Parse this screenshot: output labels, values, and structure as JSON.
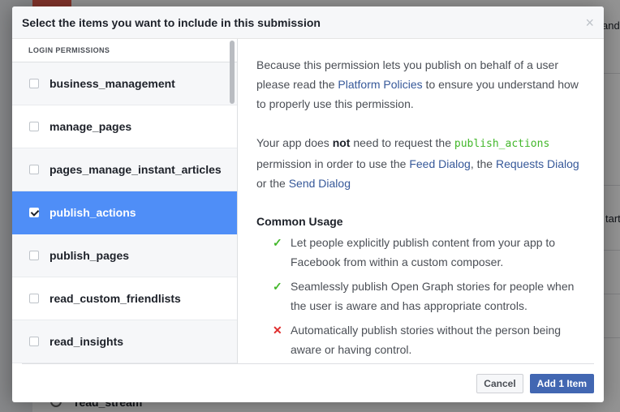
{
  "dialog": {
    "title": "Select the items you want to include in this submission",
    "close_icon": "×",
    "cancel_label": "Cancel",
    "add_label": "Add 1 Item"
  },
  "sidebar": {
    "section_header": "LOGIN PERMISSIONS",
    "items": [
      {
        "label": "business_management",
        "checked": false
      },
      {
        "label": "manage_pages",
        "checked": false
      },
      {
        "label": "pages_manage_instant_articles",
        "checked": false
      },
      {
        "label": "publish_actions",
        "checked": true
      },
      {
        "label": "publish_pages",
        "checked": false
      },
      {
        "label": "read_custom_friendlists",
        "checked": false
      },
      {
        "label": "read_insights",
        "checked": false
      }
    ]
  },
  "detail": {
    "p1_before": "Because this permission lets you publish on behalf of a user please read the ",
    "p1_link": "Platform Policies",
    "p1_after": " to ensure you understand how to properly use this permission.",
    "p2_a": "Your app does ",
    "p2_bold": "not",
    "p2_b": " need to request the ",
    "p2_code": "publish_actions",
    "p2_c": " permission in order to use the ",
    "p2_link1": "Feed Dialog",
    "p2_d": ", the ",
    "p2_link2": "Requests Dialog",
    "p2_e": " or the ",
    "p2_link3": "Send Dialog",
    "usage_title": "Common Usage",
    "usage": [
      {
        "icon": "check-icon",
        "symbol": "✓",
        "text": "Let people explicitly publish content from your app to Facebook from within a custom composer."
      },
      {
        "icon": "check-icon",
        "symbol": "✓",
        "text": "Seamlessly publish Open Graph stories for people when the user is aware and has appropriate controls."
      },
      {
        "icon": "cross-icon",
        "symbol": "✕",
        "text": "Automatically publish stories without the person being aware or having control."
      }
    ]
  },
  "background": {
    "partial_text_1": "and",
    "partial_text_2": "tart",
    "partial_text_3": "read_stream"
  },
  "colors": {
    "selected_row": "#4f8ef7",
    "primary_button": "#4267b2",
    "link": "#365899",
    "code_green": "#42b72a",
    "cross_red": "#e02d2d"
  }
}
